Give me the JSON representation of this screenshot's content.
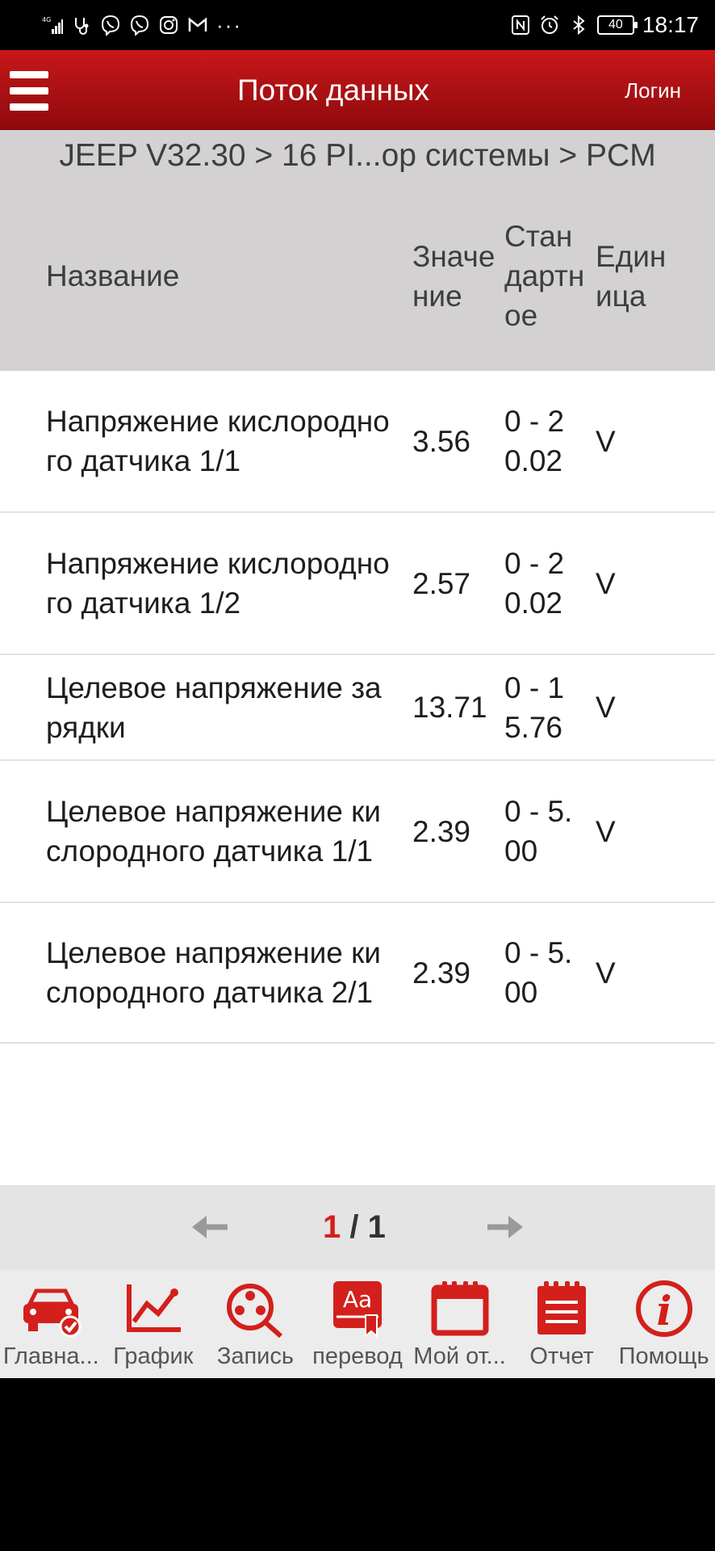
{
  "status_bar": {
    "network": "4G",
    "battery": "40",
    "time": "18:17",
    "more": "···"
  },
  "app_bar": {
    "title": "Поток данных",
    "login_label": "Логин"
  },
  "breadcrumb": "JEEP V32.30 > 16 PI...ор системы > PCM",
  "table": {
    "headers": {
      "name": "Название",
      "value": "Значение",
      "standard": "Стандартное",
      "unit": "Единица"
    },
    "rows": [
      {
        "name": "Напряжение кислородного датчика 1/1",
        "value": "3.56",
        "standard": "0 - 20.02",
        "unit": "V"
      },
      {
        "name": "Напряжение кислородного датчика 1/2",
        "value": "2.57",
        "standard": "0 - 20.02",
        "unit": "V"
      },
      {
        "name": "Целевое напряжение зарядки",
        "value": "13.71",
        "standard": "0 - 15.76",
        "unit": "V"
      },
      {
        "name": "Целевое напряжение кислородного датчика 1/1",
        "value": "2.39",
        "standard": "0 - 5.00",
        "unit": "V"
      },
      {
        "name": "Целевое напряжение кислородного датчика 2/1",
        "value": "2.39",
        "standard": "0 - 5.00",
        "unit": "V"
      }
    ]
  },
  "pager": {
    "current": "1",
    "separator": " / ",
    "total": "1"
  },
  "bottom_nav": [
    {
      "label": "Главна...",
      "icon": "car-check-icon"
    },
    {
      "label": "График",
      "icon": "graph-icon"
    },
    {
      "label": "Запись",
      "icon": "film-reel-search-icon"
    },
    {
      "label": "перевод",
      "icon": "translate-book-icon"
    },
    {
      "label": "Мой от...",
      "icon": "calendar-icon"
    },
    {
      "label": "Отчет",
      "icon": "report-notepad-icon"
    },
    {
      "label": "Помощь",
      "icon": "info-icon"
    }
  ],
  "colors": {
    "accent": "#d3201c",
    "app_bar_top": "#c8171a",
    "app_bar_bottom": "#8e0a0c",
    "header_bg": "#d3d1d1"
  }
}
